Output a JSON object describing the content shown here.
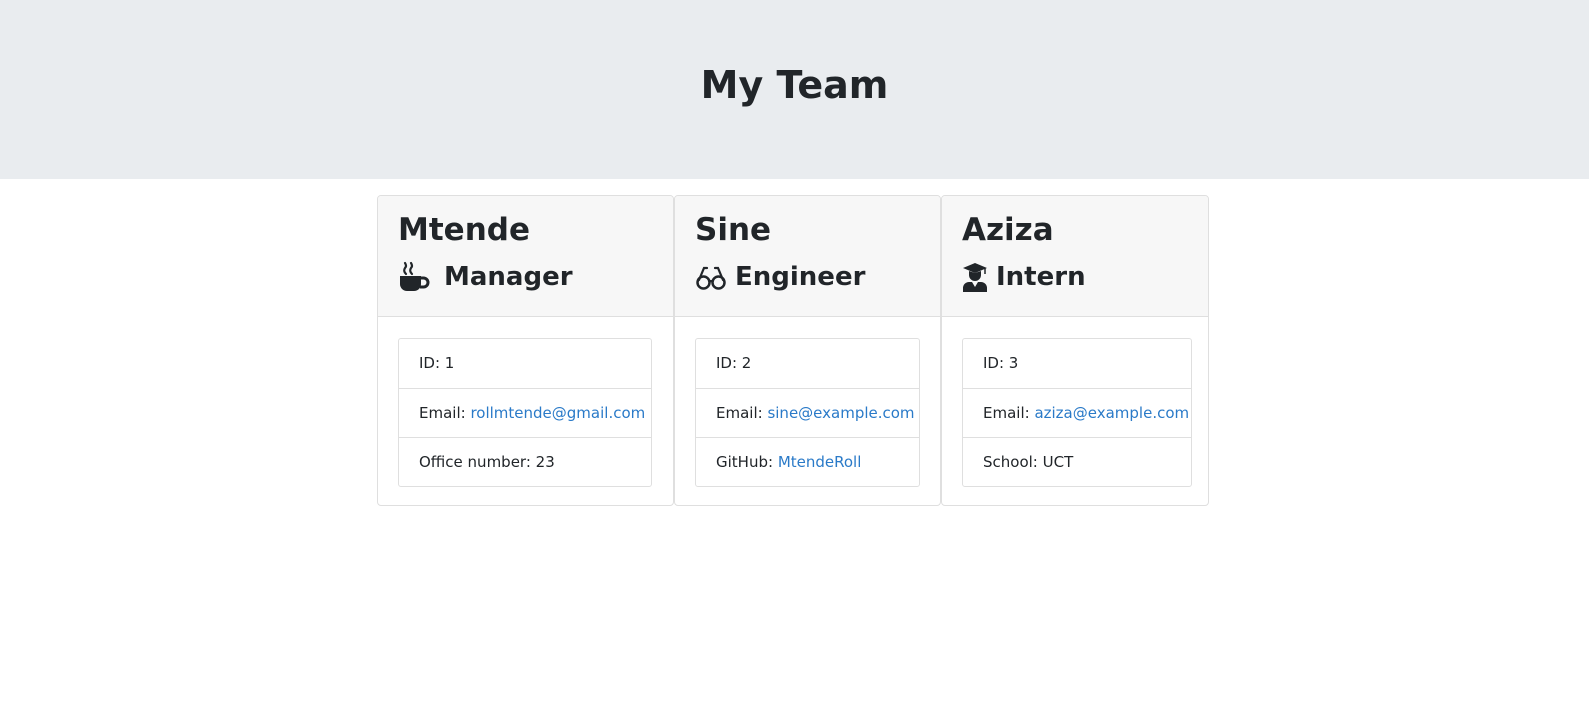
{
  "header": {
    "title": "My Team"
  },
  "colors": {
    "jumbotron": "#e9ecef",
    "link": "#2a7ac8",
    "card_header": "#f7f7f7"
  },
  "team": [
    {
      "name": "Mtende",
      "role": "Manager",
      "icon": "coffee-mug-icon",
      "details": [
        {
          "label": "ID: ",
          "value": "1",
          "is_link": false
        },
        {
          "label": "Email: ",
          "value": "rollmtende@gmail.com",
          "is_link": true
        },
        {
          "label": "Office number: ",
          "value": "23",
          "is_link": false
        }
      ]
    },
    {
      "name": "Sine",
      "role": "Engineer",
      "icon": "glasses-icon",
      "details": [
        {
          "label": "ID: ",
          "value": "2",
          "is_link": false
        },
        {
          "label": "Email: ",
          "value": "sine@example.com",
          "is_link": true
        },
        {
          "label": "GitHub: ",
          "value": "MtendeRoll",
          "is_link": true
        }
      ]
    },
    {
      "name": "Aziza",
      "role": "Intern",
      "icon": "graduate-icon",
      "details": [
        {
          "label": "ID: ",
          "value": "3",
          "is_link": false
        },
        {
          "label": "Email: ",
          "value": "aziza@example.com",
          "is_link": true
        },
        {
          "label": "School: ",
          "value": "UCT",
          "is_link": false
        }
      ]
    }
  ]
}
